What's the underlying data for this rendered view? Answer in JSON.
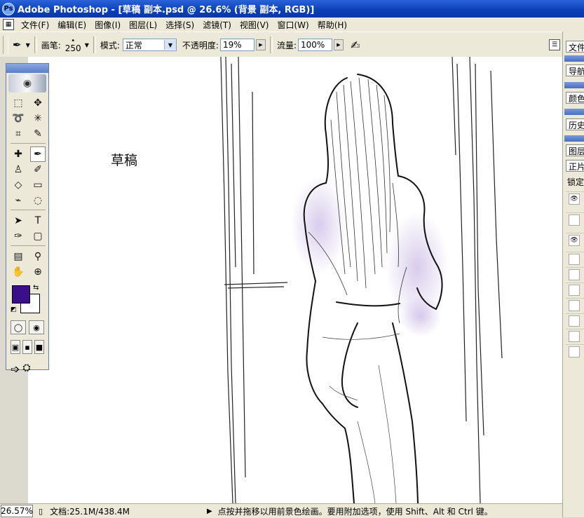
{
  "window": {
    "title": "Adobe Photoshop - [草稿 副本.psd @ 26.6% (背景 副本, RGB)]"
  },
  "menu": [
    "文件(F)",
    "编辑(E)",
    "图像(I)",
    "图层(L)",
    "选择(S)",
    "滤镜(T)",
    "视图(V)",
    "窗口(W)",
    "帮助(H)"
  ],
  "options": {
    "brush_label": "画笔:",
    "brush_size": "250",
    "mode_label": "模式:",
    "mode_value": "正常",
    "opacity_label": "不透明度:",
    "opacity_value": "19%",
    "flow_label": "流量:",
    "flow_value": "100%"
  },
  "colors": {
    "foreground": "#3a0f8a",
    "background": "#ffffff",
    "title_bar": "#0a3fb8"
  },
  "canvas": {
    "annotation": "草稿"
  },
  "right_panel": {
    "tab_file": "文件",
    "tab_navigator": "导航",
    "tab_color": "颜色",
    "tab_history": "历史",
    "tab_layers": "图层",
    "blend_mode": "正片",
    "lock_label": "锁定"
  },
  "status": {
    "zoom": "26.57%",
    "doc_size": "文档:25.1M/438.4M",
    "hint": "点按并拖移以用前景色绘画。要用附加选项，使用 Shift、Alt 和 Ctrl 键。"
  }
}
